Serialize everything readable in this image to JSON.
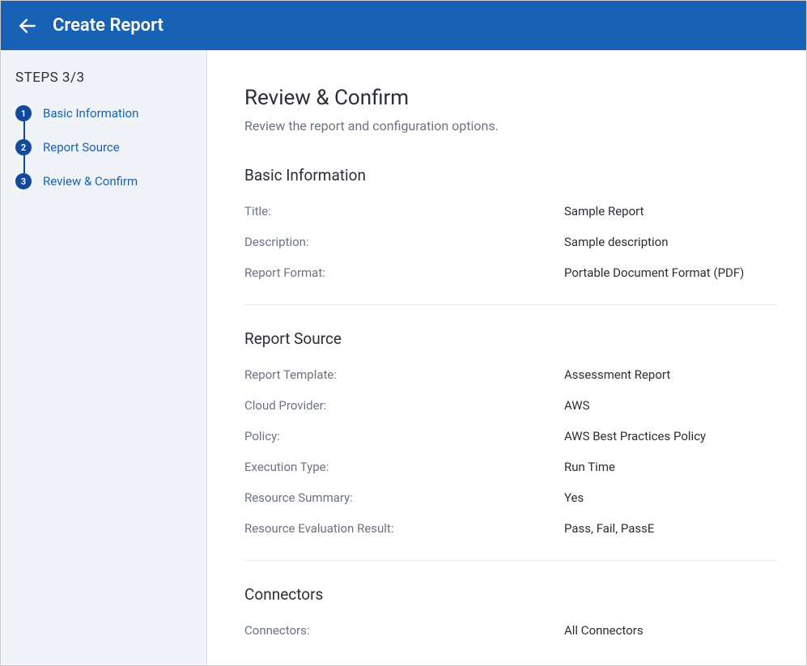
{
  "header": {
    "title": "Create Report"
  },
  "sidebar": {
    "steps_label": "STEPS 3/3",
    "steps": [
      {
        "num": "1",
        "label": "Basic Information"
      },
      {
        "num": "2",
        "label": "Report Source"
      },
      {
        "num": "3",
        "label": "Review & Confirm"
      }
    ]
  },
  "main": {
    "title": "Review & Confirm",
    "subtitle": "Review the report and configuration options.",
    "sections": [
      {
        "title": "Basic Information",
        "fields": [
          {
            "label": "Title:",
            "value": "Sample Report"
          },
          {
            "label": "Description:",
            "value": "Sample description"
          },
          {
            "label": "Report Format:",
            "value": "Portable Document Format (PDF)"
          }
        ]
      },
      {
        "title": "Report Source",
        "fields": [
          {
            "label": "Report Template:",
            "value": "Assessment Report"
          },
          {
            "label": "Cloud Provider:",
            "value": "AWS"
          },
          {
            "label": "Policy:",
            "value": "AWS Best Practices Policy"
          },
          {
            "label": "Execution Type:",
            "value": "Run Time"
          },
          {
            "label": "Resource Summary:",
            "value": "Yes"
          },
          {
            "label": "Resource Evaluation Result:",
            "value": "Pass, Fail, PassE"
          }
        ]
      },
      {
        "title": "Connectors",
        "fields": [
          {
            "label": "Connectors:",
            "value": "All Connectors"
          }
        ]
      }
    ]
  }
}
